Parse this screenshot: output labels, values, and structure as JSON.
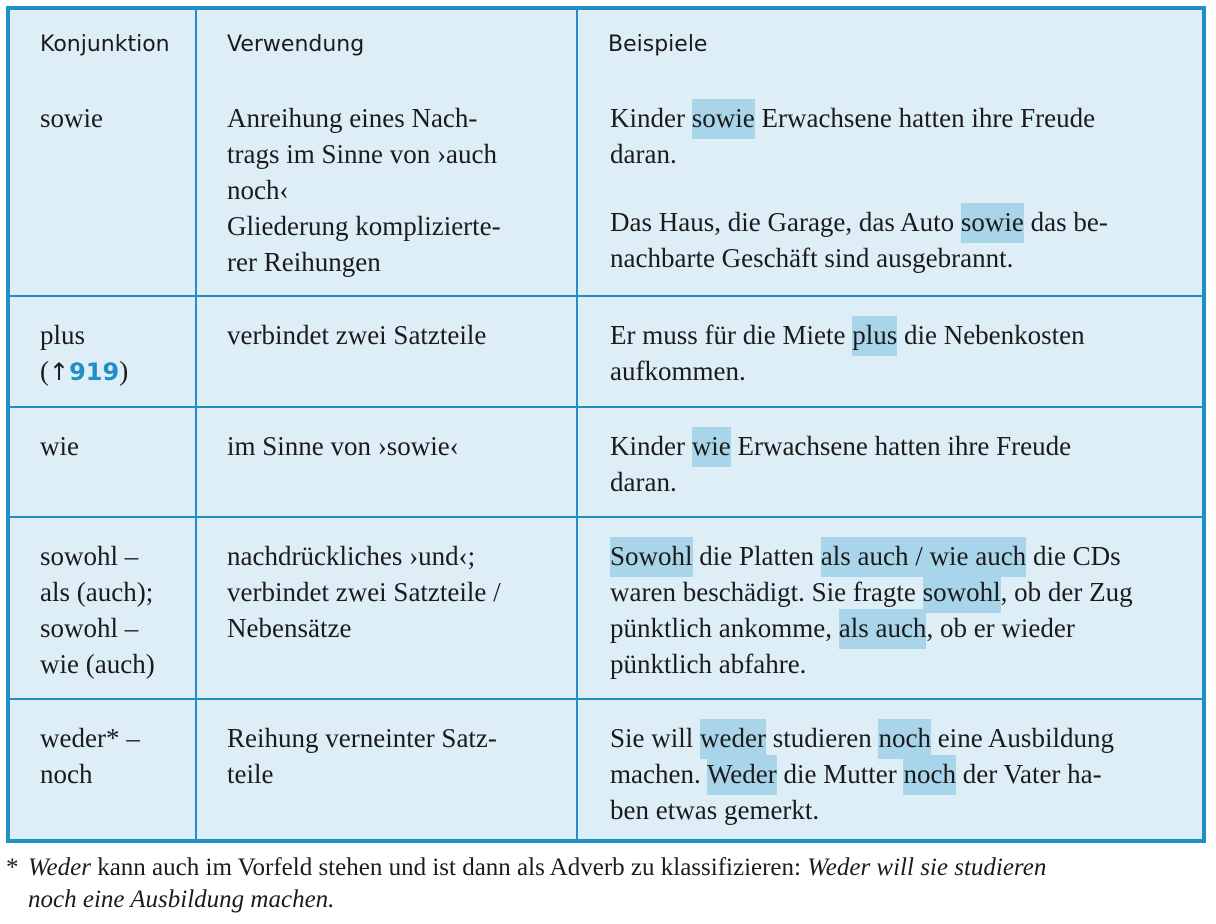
{
  "table": {
    "headers": [
      "Konjunktion",
      "Verwendung",
      "Beispiele"
    ],
    "rows": [
      {
        "konjunktion": [
          "sowie"
        ],
        "verwendung": [
          "Anreihung eines Nach-",
          "trags im Sinne von ›auch",
          "noch‹",
          "Gliederung komplizierte-",
          "rer Reihungen"
        ],
        "beispiele": [
          [
            [
              {
                "t": "Kinder "
              },
              {
                "t": "sowie",
                "hl": true
              },
              {
                "t": " Erwachsene hatten ihre Freude"
              }
            ],
            [
              {
                "t": "daran."
              }
            ]
          ],
          [
            [
              {
                "t": "Das Haus, die Garage, das Auto "
              },
              {
                "t": "sowie",
                "hl": true
              },
              {
                "t": " das be-"
              }
            ],
            [
              {
                "t": "nachbarte Geschäft sind ausgebrannt."
              }
            ]
          ]
        ]
      },
      {
        "konjunktion": [
          "plus"
        ],
        "konjunktion_ref": {
          "open": "(",
          "arrow": "↑",
          "number": "919",
          "close": ")"
        },
        "verwendung": [
          "verbindet zwei Satzteile"
        ],
        "beispiele": [
          [
            [
              {
                "t": "Er muss für die Miete "
              },
              {
                "t": "plus",
                "hl": true
              },
              {
                "t": " die Nebenkosten"
              }
            ],
            [
              {
                "t": "aufkommen."
              }
            ]
          ]
        ]
      },
      {
        "konjunktion": [
          "wie"
        ],
        "verwendung": [
          "im Sinne von ›sowie‹"
        ],
        "beispiele": [
          [
            [
              {
                "t": "Kinder "
              },
              {
                "t": "wie",
                "hl": true
              },
              {
                "t": " Erwachsene hatten ihre Freude"
              }
            ],
            [
              {
                "t": "daran."
              }
            ]
          ]
        ]
      },
      {
        "konjunktion": [
          "sowohl –",
          "als (auch);",
          "sowohl –",
          "wie (auch)"
        ],
        "verwendung": [
          "nachdrückliches ›und‹;",
          "verbindet zwei Satzteile /",
          "Nebensätze"
        ],
        "beispiele": [
          [
            [
              {
                "t": "Sowohl",
                "hl": true
              },
              {
                "t": " die Platten "
              },
              {
                "t": "als auch / wie auch",
                "hl": true
              },
              {
                "t": " die CDs"
              }
            ],
            [
              {
                "t": "waren beschädigt. Sie fragte "
              },
              {
                "t": "sowohl",
                "hl": true
              },
              {
                "t": ", ob der Zug"
              }
            ],
            [
              {
                "t": "pünktlich ankomme, "
              },
              {
                "t": "als auch",
                "hl": true
              },
              {
                "t": ", ob er wieder"
              }
            ],
            [
              {
                "t": "pünktlich abfahre."
              }
            ]
          ]
        ]
      },
      {
        "konjunktion": [
          "weder* –",
          "noch"
        ],
        "verwendung": [
          "Reihung verneinter Satz-",
          "teile"
        ],
        "beispiele": [
          [
            [
              {
                "t": "Sie will "
              },
              {
                "t": "weder",
                "hl": true
              },
              {
                "t": " studieren "
              },
              {
                "t": "noch",
                "hl": true
              },
              {
                "t": " eine Ausbildung"
              }
            ],
            [
              {
                "t": "machen. "
              },
              {
                "t": "Weder",
                "hl": true
              },
              {
                "t": " die Mutter "
              },
              {
                "t": "noch",
                "hl": true
              },
              {
                "t": " der Vater ha-"
              }
            ],
            [
              {
                "t": "ben etwas gemerkt."
              }
            ]
          ]
        ]
      }
    ]
  },
  "footnote": {
    "marker": "*",
    "line1": [
      {
        "t": "Weder",
        "i": true
      },
      {
        "t": " kann auch im Vorfeld stehen und ist dann als Adverb zu klassifizieren: "
      },
      {
        "t": "Weder will sie studieren",
        "i": true
      }
    ],
    "line2": [
      {
        "t": "noch eine Ausbildung machen.",
        "i": true
      }
    ]
  },
  "colors": {
    "border": "#1f8fc5",
    "cell_background": "#ddeef7",
    "highlight": "#a9d5ea",
    "reference": "#1f8fc5"
  }
}
